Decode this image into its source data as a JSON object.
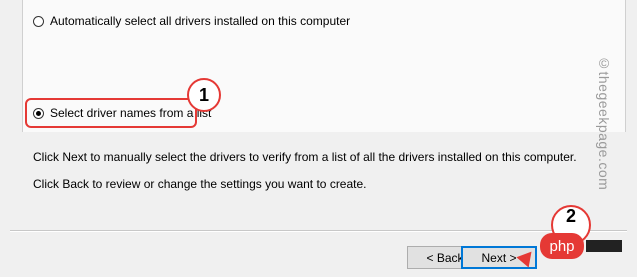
{
  "options": [
    {
      "label": "Automatically select all drivers installed on this computer",
      "selected": false
    },
    {
      "label": "Select driver names from a list",
      "selected": true
    }
  ],
  "info": {
    "line1": "Click Next to manually select the drivers to verify from a list of all the drivers installed on this computer.",
    "line2": "Click Back to review or change the settings you want to create."
  },
  "buttons": {
    "back": "< Back",
    "next": "Next >"
  },
  "annotations": {
    "step1": "1",
    "step2": "2",
    "accent_color": "#e53935"
  },
  "watermark": "©thegeekpage.com",
  "php_logo": "php"
}
